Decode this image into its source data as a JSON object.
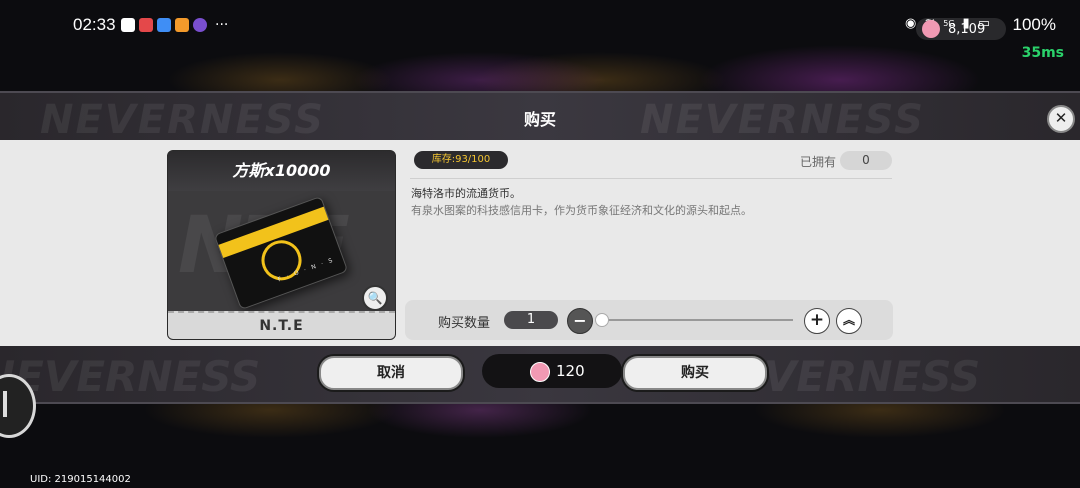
{
  "status_bar": {
    "time": "02:33",
    "more": "···",
    "battery": "100%",
    "network_label": "5G",
    "ping": "35ms",
    "currency_amount": "8,109"
  },
  "modal": {
    "title": "购买",
    "close_symbol": "✕"
  },
  "item": {
    "name": "方斯x10000",
    "brand": "N.T.E",
    "card_text": "F · O · N · S",
    "stock": "库存:93/100",
    "owned_label": "已拥有",
    "owned_value": "0",
    "description_line1": "海特洛市的流通货币。",
    "description_line2": "有泉水图案的科技感信用卡，作为货币象征经济和文化的源头和起点。"
  },
  "quantity": {
    "label": "购买数量",
    "value": "1",
    "minus_symbol": "−",
    "plus_symbol": "+",
    "max_symbol": "︽",
    "fraction": 0
  },
  "actions": {
    "cancel": "取消",
    "buy": "购买",
    "cost": "120"
  },
  "uid": "UID: 219015144002",
  "watermark": "NEVERNESS",
  "colors": {
    "stock_text": "#f4c531",
    "ping": "#2bd26b",
    "coin": "#f199b3"
  }
}
